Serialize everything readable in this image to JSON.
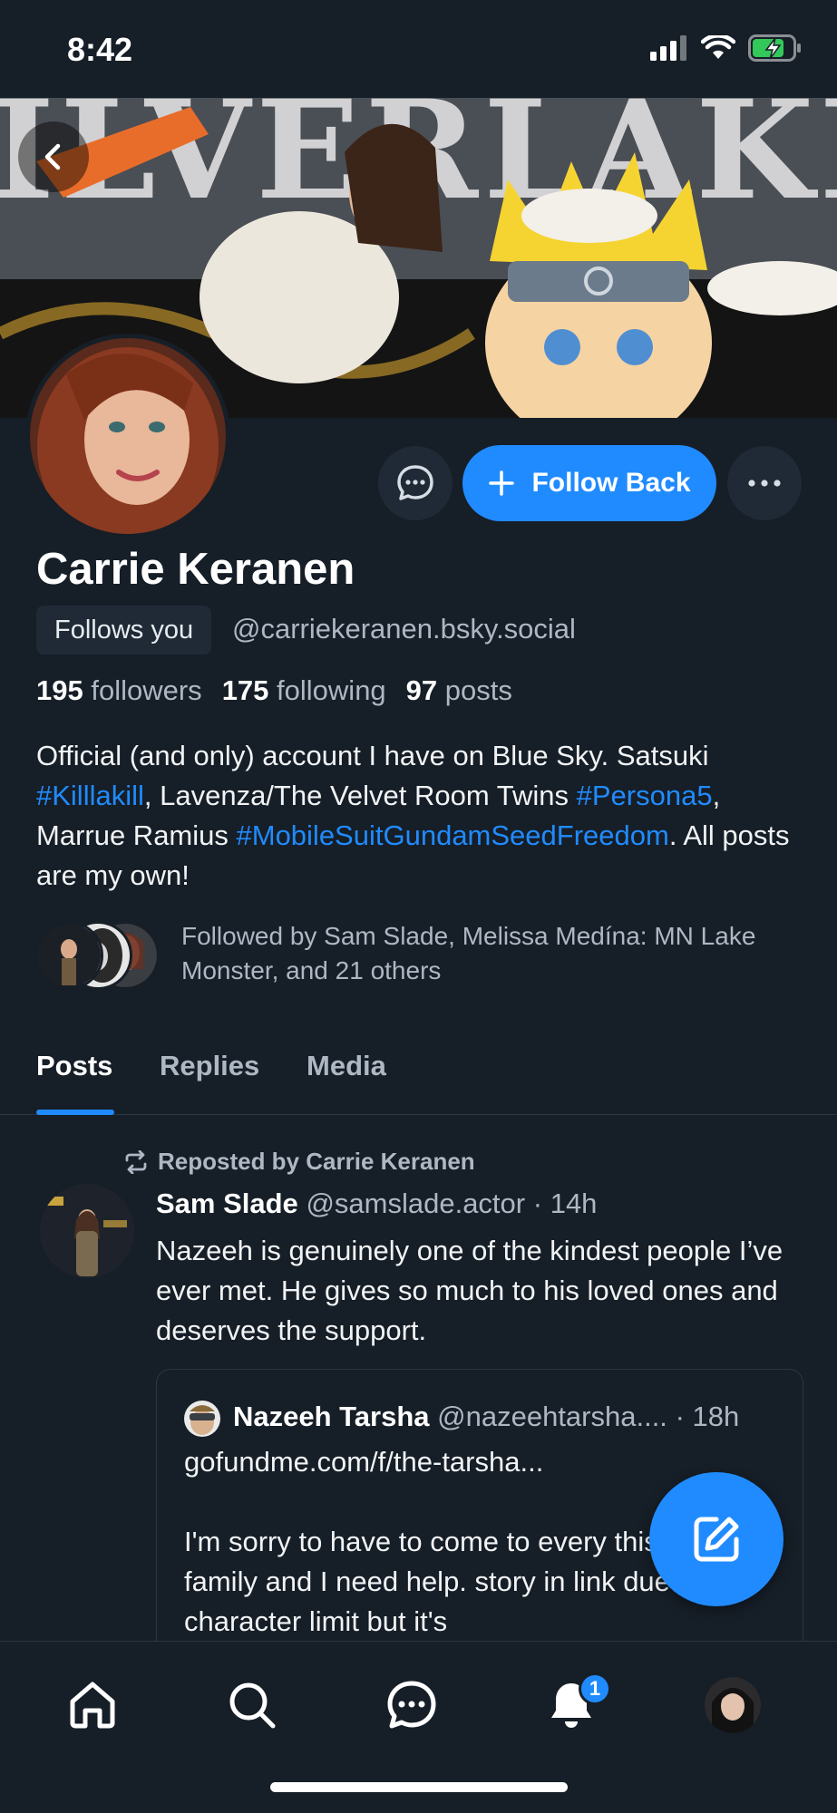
{
  "status_bar": {
    "time": "8:42",
    "icons": [
      "signal-icon",
      "wifi-icon",
      "battery-charging-icon"
    ]
  },
  "profile": {
    "display_name": "Carrie Keranen",
    "follows_you_label": "Follows you",
    "handle": "@carriekeranen.bsky.social",
    "stats": {
      "followers_count": "195",
      "followers_label": "followers",
      "following_count": "175",
      "following_label": "following",
      "posts_count": "97",
      "posts_label": "posts"
    },
    "bio": {
      "part1": "Official (and only) account I have on Blue Sky. Satsuki ",
      "tag1": "#Killlakill",
      "part2": ", Lavenza/The Velvet Room Twins ",
      "tag2": "#Persona5",
      "part3": ", Marrue Ramius ",
      "tag3": "#MobileSuitGundamSeedFreedom",
      "part4": ". All posts are my own!"
    },
    "followed_by": "Followed by Sam Slade, Melissa Medína: MN Lake Monster, and 21 others"
  },
  "actions": {
    "follow_back_label": "Follow Back"
  },
  "tabs": [
    {
      "label": "Posts",
      "active": true
    },
    {
      "label": "Replies",
      "active": false
    },
    {
      "label": "Media",
      "active": false
    }
  ],
  "feed": {
    "post": {
      "repost_label": "Reposted by Carrie Keranen",
      "author_name": "Sam Slade",
      "author_handle": "@samslade.actor",
      "time": "14h",
      "text": "Nazeeh is genuinely one of the kindest people I’ve ever met. He gives so much to his loved ones and deserves the support.",
      "quote": {
        "author_name": "Nazeeh Tarsha",
        "author_handle": "@nazeehtarsha....",
        "time": "18h",
        "body": "gofundme.com/f/the-tarsha...\n\nI'm sorry to have to come to every this but my family and I need help. story in link due to character limit but it's"
      }
    }
  },
  "bottom_nav": {
    "items": [
      "home-icon",
      "search-icon",
      "chat-icon",
      "bell-icon",
      "profile-avatar"
    ],
    "notification_badge": "1"
  },
  "colors": {
    "background": "#161e27",
    "accent": "#208bfe",
    "muted_text": "#aeb8c4",
    "surface": "#1f2a36"
  }
}
